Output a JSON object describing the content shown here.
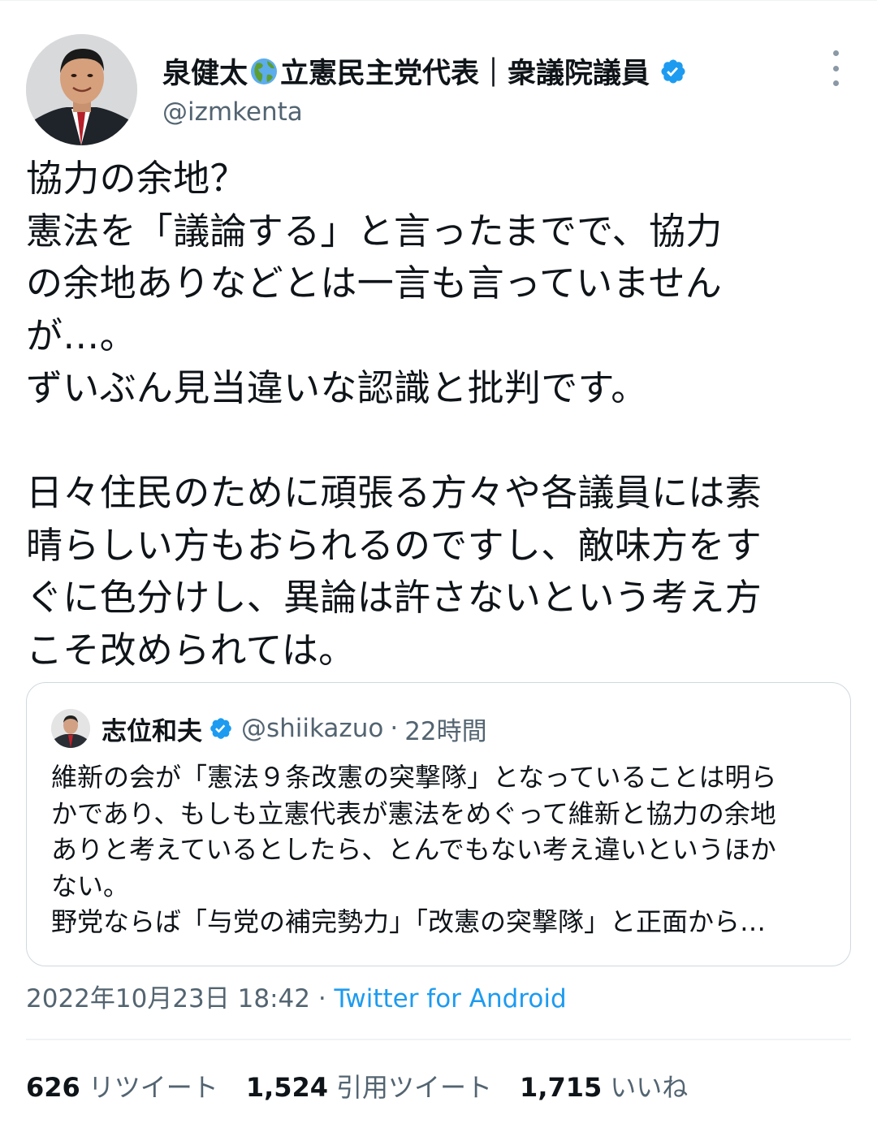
{
  "tweet": {
    "author": {
      "name_before_emoji": "泉健太",
      "name_after_emoji": "立憲民主党代表｜衆議院議員",
      "emoji_icon": "globe-americas-icon",
      "handle": "@izmkenta",
      "verified": true
    },
    "text_lines": [
      "協力の余地？",
      "憲法を「議論する」と言ったまでで、協力",
      "の余地ありなどとは一言も言っていません",
      "が…。",
      "ずいぶん見当違いな認識と批判です。",
      "",
      "日々住民のために頑張る方々や各議員には素",
      "晴らしい方もおられるのですし、敵味方をす",
      "ぐに色分けし、異論は許さないという考え方",
      "こそ改められては。"
    ],
    "quote": {
      "author_name": "志位和夫",
      "handle": "@shiikazuo",
      "separator": "·",
      "time": "22時間",
      "verified": true,
      "text_lines": [
        "維新の会が「憲法９条改憲の突撃隊」となっていることは明ら",
        "かであり、もしも立憲代表が憲法をめぐって維新と協力の余地",
        "ありと考えているとしたら、とんでもない考え違いというほか",
        "ない。",
        "野党ならば「与党の補完勢力」「改憲の突撃隊」と正面から…"
      ]
    },
    "timestamp": "2022年10月23日 18:42",
    "timestamp_separator": " · ",
    "source": "Twitter for Android",
    "stats": [
      {
        "count": "626",
        "label": "リツイート"
      },
      {
        "count": "1,524",
        "label": "引用ツイート"
      },
      {
        "count": "1,715",
        "label": "いいね"
      }
    ],
    "colors": {
      "accent": "#1d9bf0",
      "secondary_text": "#536471",
      "primary_text": "#0f1419",
      "border": "#cfd9de"
    }
  }
}
